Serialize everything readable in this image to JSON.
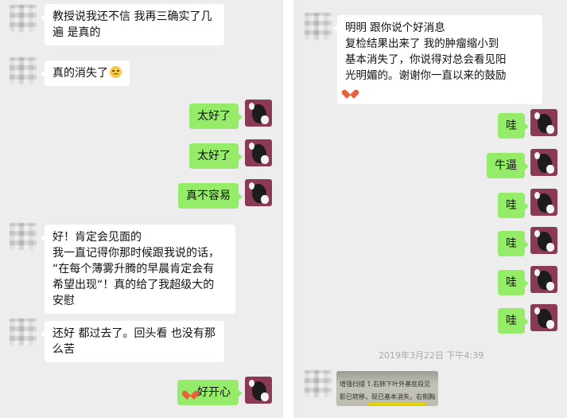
{
  "left_chat": {
    "messages": [
      {
        "text": "教授说我还不信 我再三确实了几\n遍 是真的"
      },
      {
        "text": "真的消失了"
      },
      {
        "text": "太好了"
      },
      {
        "text": "太好了"
      },
      {
        "text": "真不容易"
      },
      {
        "text": "好！肯定会见面的\n我一直记得你那时候跟我说的话，\n“在每个薄雾升腾的早晨肯定会有\n希望出现“！真的给了我超级大的\n安慰"
      },
      {
        "text": "还好 都过去了。回头看 也没有那\n么苦"
      },
      {
        "text": "好开心"
      }
    ]
  },
  "right_chat": {
    "messages": [
      {
        "text": "明明 跟你说个好消息\n复检结果出来了 我的肿瘤缩小到\n基本消失了，你说得对总会看见阳\n光明媚的。谢谢你一直以来的鼓励"
      },
      {
        "text": "哇"
      },
      {
        "text": "牛逼"
      },
      {
        "text": "哇"
      },
      {
        "text": "哇"
      },
      {
        "text": "哇"
      },
      {
        "text": "哇"
      }
    ],
    "timestamp": "2019年3月22日 下午4:39",
    "photo_lines": [
      "增强扫描 1.右肺下叶外基底段见",
      "影已转移，现已基本消失，右侧胸"
    ]
  },
  "colors": {
    "incoming_bubble": "#ffffff",
    "outgoing_bubble": "#95ec69",
    "chat_background": "#ededed"
  },
  "icons": {
    "crying_emoji": "crying-face-emoji",
    "heart_emoji": "heart-emoji"
  }
}
